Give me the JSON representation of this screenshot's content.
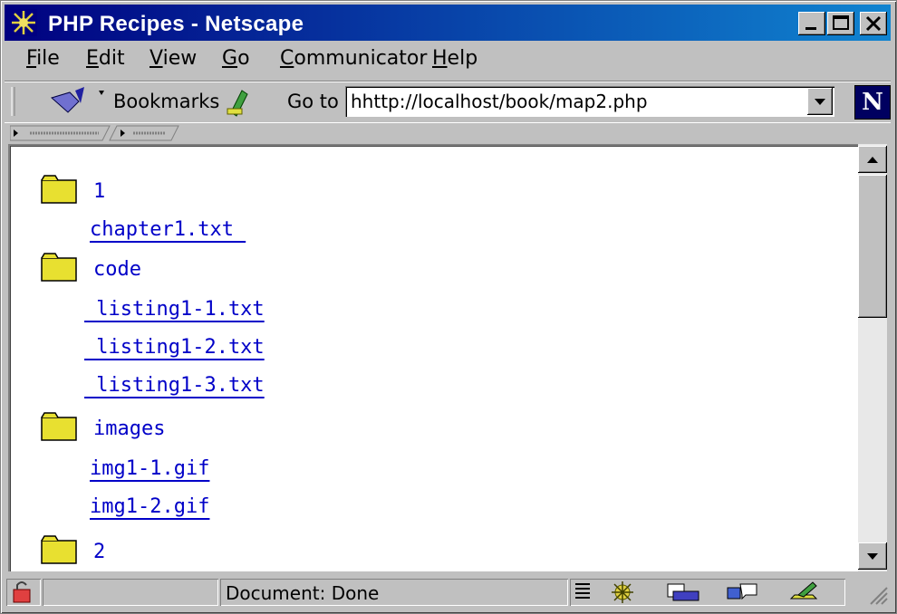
{
  "window": {
    "title": "PHP Recipes - Netscape",
    "controls": [
      "minimize-icon",
      "maximize-icon",
      "close-icon"
    ]
  },
  "menu": {
    "items": [
      {
        "mnemonic": "F",
        "rest": "ile"
      },
      {
        "mnemonic": "E",
        "rest": "dit"
      },
      {
        "mnemonic": "V",
        "rest": "iew"
      },
      {
        "mnemonic": "G",
        "rest": "o"
      },
      {
        "mnemonic": "C",
        "rest": "ommunicator"
      },
      {
        "mnemonic": "H",
        "rest": "elp"
      }
    ]
  },
  "toolbar": {
    "bookmarks_label": "Bookmarks",
    "goto_label": "Go to",
    "url": "hhttp://localhost/book/map2.php"
  },
  "content": {
    "dir1": "1",
    "dir1_files": [
      "chapter1.txt "
    ],
    "dir2": "code",
    "dir2_files": [
      " listing1-1.txt",
      " listing1-2.txt",
      " listing1-3.txt"
    ],
    "dir3": "images",
    "dir3_files": [
      "img1-1.gif",
      "img1-2.gif"
    ],
    "dir4": "2"
  },
  "status": {
    "text": "Document: Done"
  },
  "colors": {
    "title_gradient_start": "#000080",
    "title_gradient_end": "#1084d0",
    "link": "#0000c8",
    "folder": "#e8e030"
  }
}
